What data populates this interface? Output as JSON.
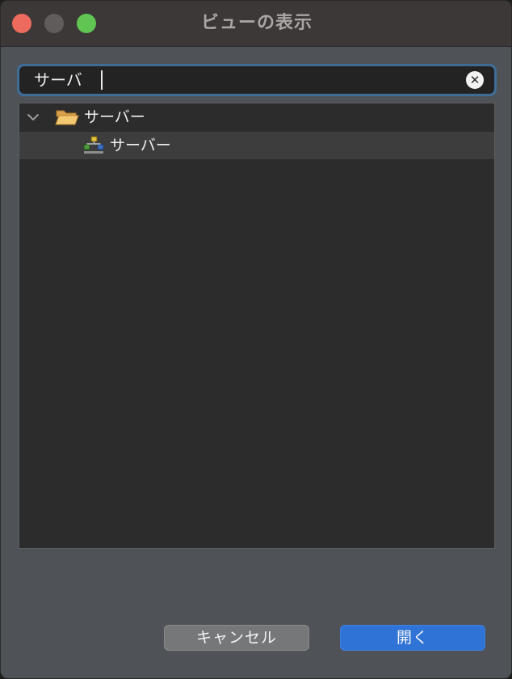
{
  "window": {
    "title": "ビューの表示"
  },
  "search": {
    "value": "サーバ",
    "clear_icon": "clear-icon"
  },
  "tree": {
    "items": [
      {
        "label": "サーバー",
        "icon": "folder-open-icon",
        "expanded": true
      },
      {
        "label": "サーバー",
        "icon": "servers-view-icon",
        "selected": true
      }
    ]
  },
  "buttons": {
    "cancel_label": "キャンセル",
    "open_label": "開く"
  },
  "colors": {
    "accent": "#2f73d6",
    "focus_ring": "#3f6c97",
    "close": "#ec6a5e",
    "zoom": "#61c554"
  }
}
